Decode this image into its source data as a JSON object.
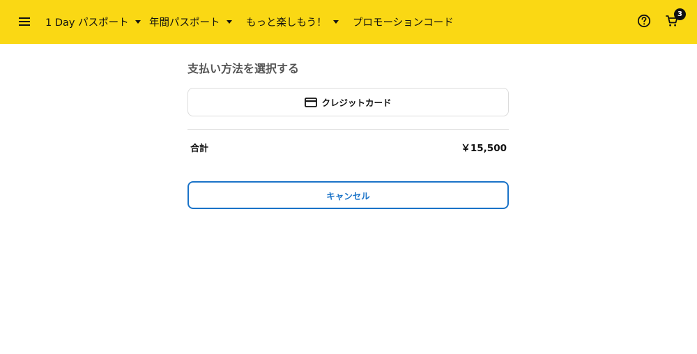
{
  "header": {
    "nav": [
      {
        "label": "1 Day パスポート"
      },
      {
        "label": "年間パスポート"
      },
      {
        "label": "もっと楽しもう！"
      },
      {
        "label": "プロモーションコード"
      }
    ],
    "cart_count": "3",
    "icons": {
      "menu": "hamburger-menu-icon",
      "help": "help-circle-icon",
      "cart": "shopping-cart-icon",
      "dropdown": "caret-down-icon"
    }
  },
  "payment": {
    "section_title": "支払い方法を選択する",
    "method_label": "クレジットカード",
    "method_icon": "credit-card-icon"
  },
  "summary": {
    "total_label": "合計",
    "total_value": "￥15,500"
  },
  "actions": {
    "cancel_label": "キャンセル"
  },
  "colors": {
    "header_bg": "#fad814",
    "accent_blue": "#1a73c8",
    "border": "#dcdcdc"
  }
}
